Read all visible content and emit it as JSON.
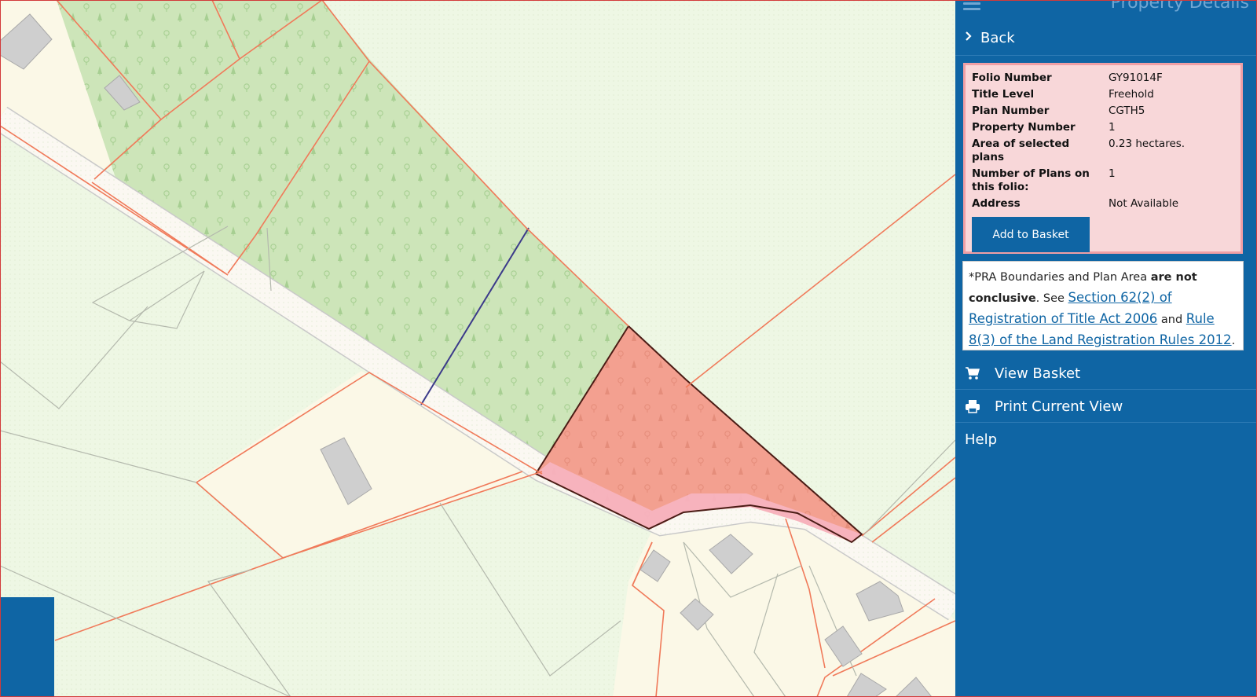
{
  "panel": {
    "title": "Property Details",
    "back_label": "Back",
    "details": {
      "folio_number_label": "Folio Number",
      "folio_number": "GY91014F",
      "title_level_label": "Title Level",
      "title_level": "Freehold",
      "plan_number_label": "Plan Number",
      "plan_number": "CGTH5",
      "property_number_label": "Property Number",
      "property_number": "1",
      "area_label": "Area of selected plans",
      "area": "0.23 hectares.",
      "plans_count_label": "Number of Plans on this folio:",
      "plans_count": "1",
      "address_label": "Address",
      "address": "Not Available",
      "add_basket_label": "Add to Basket"
    },
    "notice": {
      "prefix": "*PRA Boundaries and Plan Area ",
      "bold": "are not conclusive",
      "see": ". See ",
      "link1": "Section 62(2) of Registration of Title Act 2006",
      "and": " and ",
      "link2": "Rule 8(3) of the Land Registration Rules 2012",
      "suffix": "."
    },
    "menu": {
      "view_basket": "View Basket",
      "print_view": "Print Current View",
      "help": "Help"
    }
  },
  "icons": {
    "menu": "hamburger-icon",
    "back": "chevron-right-icon",
    "basket": "cart-icon",
    "print": "printer-icon"
  },
  "colors": {
    "panel_bg": "#0f65a4",
    "selected_parcel": "#f3a090",
    "forest": "#c9e3b4",
    "boundary": "#f07a5a",
    "details_bg": "#f8d7d9"
  }
}
